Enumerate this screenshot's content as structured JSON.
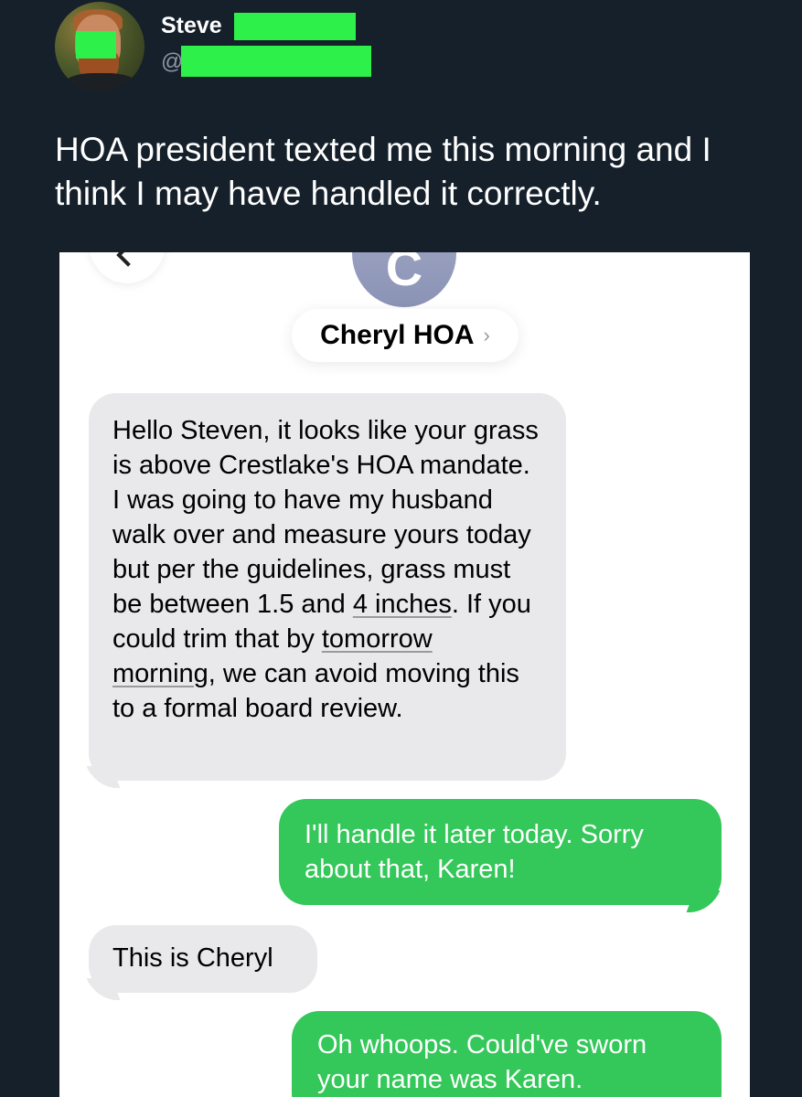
{
  "tweet": {
    "display_name": "Steve",
    "handle": "@",
    "text": "HOA president texted me this morning and I think I may have handled it correctly."
  },
  "screenshot": {
    "contact": {
      "initial": "C",
      "name": "Cheryl HOA",
      "chevron": "›"
    },
    "messages": [
      {
        "direction": "incoming",
        "parts": [
          "Hello Steven, it looks like your grass is above Crestlake's HOA mandate. I was going to have my husband walk over and measure yours today but per the guidelines, grass must be between 1.5 and ",
          "4 inches",
          ". If you could trim that by ",
          "tomorrow morning",
          ", we can avoid moving this to a formal board review."
        ]
      },
      {
        "direction": "outgoing",
        "text": "I'll handle it later today. Sorry about that, Karen!"
      },
      {
        "direction": "incoming",
        "text": "This is Cheryl"
      },
      {
        "direction": "outgoing",
        "text": "Oh whoops. Could've sworn your name was Karen."
      }
    ]
  },
  "colors": {
    "background": "#15202b",
    "redaction": "#2ef04a",
    "incoming_bubble": "#e9e9eb",
    "outgoing_bubble": "#34c759"
  }
}
